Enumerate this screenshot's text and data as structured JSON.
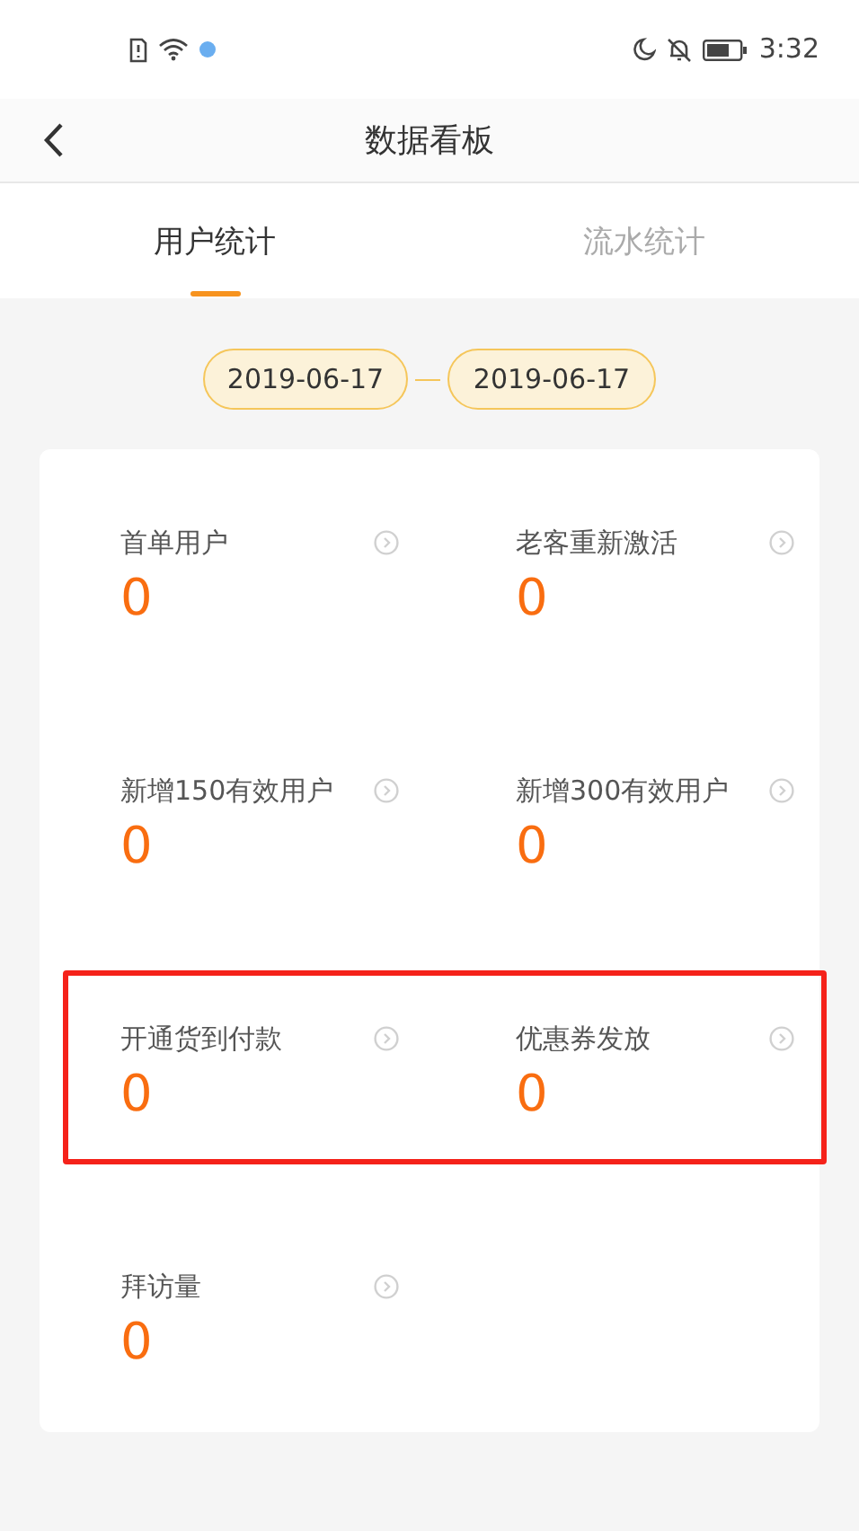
{
  "status_bar": {
    "time": "3:32"
  },
  "header": {
    "title": "数据看板"
  },
  "tabs": [
    {
      "label": "用户统计",
      "selected": true
    },
    {
      "label": "流水统计",
      "selected": false
    }
  ],
  "date_range": {
    "start": "2019-06-17",
    "end": "2019-06-17"
  },
  "stat_rows": [
    {
      "highlighted": false,
      "items": [
        {
          "label": "首单用户",
          "value": "0"
        },
        {
          "label": "老客重新激活",
          "value": "0"
        }
      ]
    },
    {
      "highlighted": false,
      "items": [
        {
          "label": "新增150有效用户",
          "value": "0"
        },
        {
          "label": "新增300有效用户",
          "value": "0"
        }
      ]
    },
    {
      "highlighted": true,
      "items": [
        {
          "label": "开通货到付款",
          "value": "0"
        },
        {
          "label": "优惠券发放",
          "value": "0"
        }
      ]
    },
    {
      "highlighted": false,
      "items": [
        {
          "label": "拜访量",
          "value": "0"
        }
      ]
    }
  ]
}
